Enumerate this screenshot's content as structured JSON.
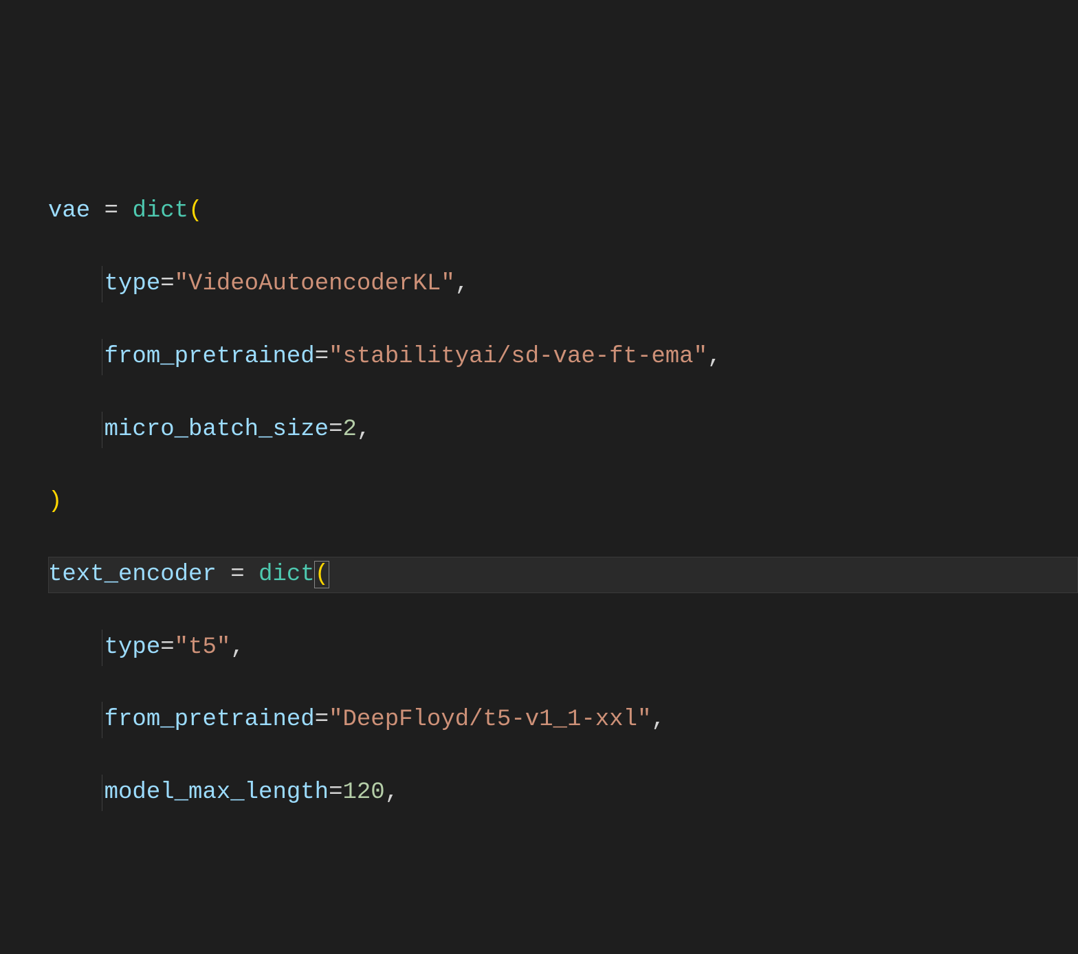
{
  "line1": {
    "var": "vae",
    "eq": " = ",
    "fn": "dict",
    "open": "("
  },
  "line2": {
    "indent": "    ",
    "param": "type",
    "eq": "=",
    "str": "\"VideoAutoencoderKL\"",
    "comma": ","
  },
  "line3": {
    "indent": "    ",
    "param": "from_pretrained",
    "eq": "=",
    "str": "\"stabilityai/sd-vae-ft-ema\"",
    "comma": ","
  },
  "line4": {
    "indent": "    ",
    "param": "micro_batch_size",
    "eq": "=",
    "num": "2",
    "comma": ","
  },
  "line5": {
    "close": ")"
  },
  "line6": {
    "var": "text_encoder",
    "eq": " = ",
    "fn": "dict",
    "open": "("
  },
  "line7": {
    "indent": "    ",
    "param": "type",
    "eq": "=",
    "str": "\"t5\"",
    "comma": ","
  },
  "line8": {
    "indent": "    ",
    "param": "from_pretrained",
    "eq": "=",
    "str": "\"DeepFloyd/t5-v1_1-xxl\"",
    "comma": ","
  },
  "line9": {
    "indent": "    ",
    "param": "model_max_length",
    "eq": "=",
    "num": "120",
    "comma": ","
  }
}
